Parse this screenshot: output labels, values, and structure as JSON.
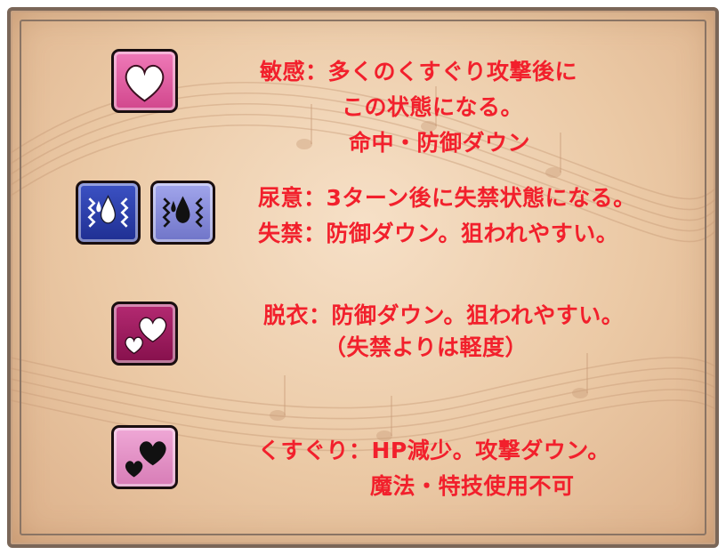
{
  "entries": [
    {
      "icon": "pink-heart-icon",
      "lines": [
        "敏感：多くのくすぐり攻撃後に",
        "この状態になる。",
        "命中・防御ダウン"
      ]
    },
    {
      "icon": "urine-drops-icon",
      "lines": [
        "尿意：3ターン後に失禁状態になる。",
        "失禁：防御ダウン。狙われやすい。"
      ]
    },
    {
      "icon": "white-hearts-icon",
      "lines": [
        "脱衣：防御ダウン。狙われやすい。",
        "（失禁よりは軽度）"
      ]
    },
    {
      "icon": "black-hearts-icon",
      "lines": [
        "くすぐり：HP減少。攻撃ダウン。",
        "魔法・特技使用不可"
      ]
    }
  ],
  "colors": {
    "text": "#f2202c",
    "panel_border": "#7a6658",
    "icon_pink": "#e0589e",
    "icon_blue": "#2a3fb0",
    "icon_lavender": "#8488d8",
    "icon_magenta": "#a0185e",
    "icon_light_pink": "#e691c8"
  }
}
